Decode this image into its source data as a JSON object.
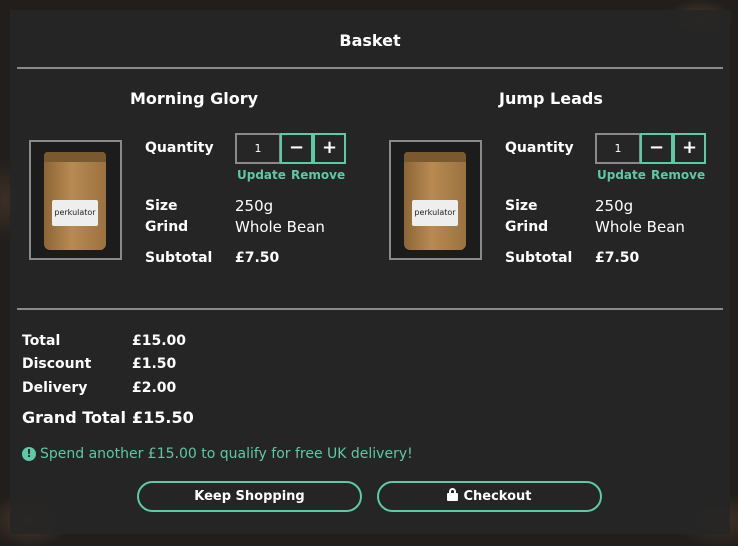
{
  "basket": {
    "title": "Basket"
  },
  "items": [
    {
      "name": "Morning Glory",
      "image_label": "perkulator",
      "quantity_label": "Quantity",
      "quantity_value": "1",
      "minus": "−",
      "plus": "+",
      "update_label": "Update",
      "remove_label": "Remove",
      "size_label": "Size",
      "size_value": "250g",
      "grind_label": "Grind",
      "grind_value": "Whole Bean",
      "subtotal_label": "Subtotal",
      "subtotal_value": "£7.50"
    },
    {
      "name": "Jump Leads",
      "image_label": "perkulator",
      "quantity_label": "Quantity",
      "quantity_value": "1",
      "minus": "−",
      "plus": "+",
      "update_label": "Update",
      "remove_label": "Remove",
      "size_label": "Size",
      "size_value": "250g",
      "grind_label": "Grind",
      "grind_value": "Whole Bean",
      "subtotal_label": "Subtotal",
      "subtotal_value": "£7.50"
    }
  ],
  "summary": {
    "total_label": "Total",
    "total_value": "£15.00",
    "discount_label": "Discount",
    "discount_value": "£1.50",
    "delivery_label": "Delivery",
    "delivery_value": "£2.00",
    "grand_total_label": "Grand Total",
    "grand_total_value": "£15.50"
  },
  "notice": {
    "icon": "info-icon",
    "icon_glyph": "!",
    "text": "Spend another £15.00 to qualify for free UK delivery!"
  },
  "actions": {
    "keep_shopping_label": "Keep Shopping",
    "checkout_label": "Checkout",
    "checkout_icon": "lock-icon"
  },
  "colors": {
    "accent": "#5cc9a7",
    "panel": "#262626",
    "divider": "#8a8a8a"
  }
}
